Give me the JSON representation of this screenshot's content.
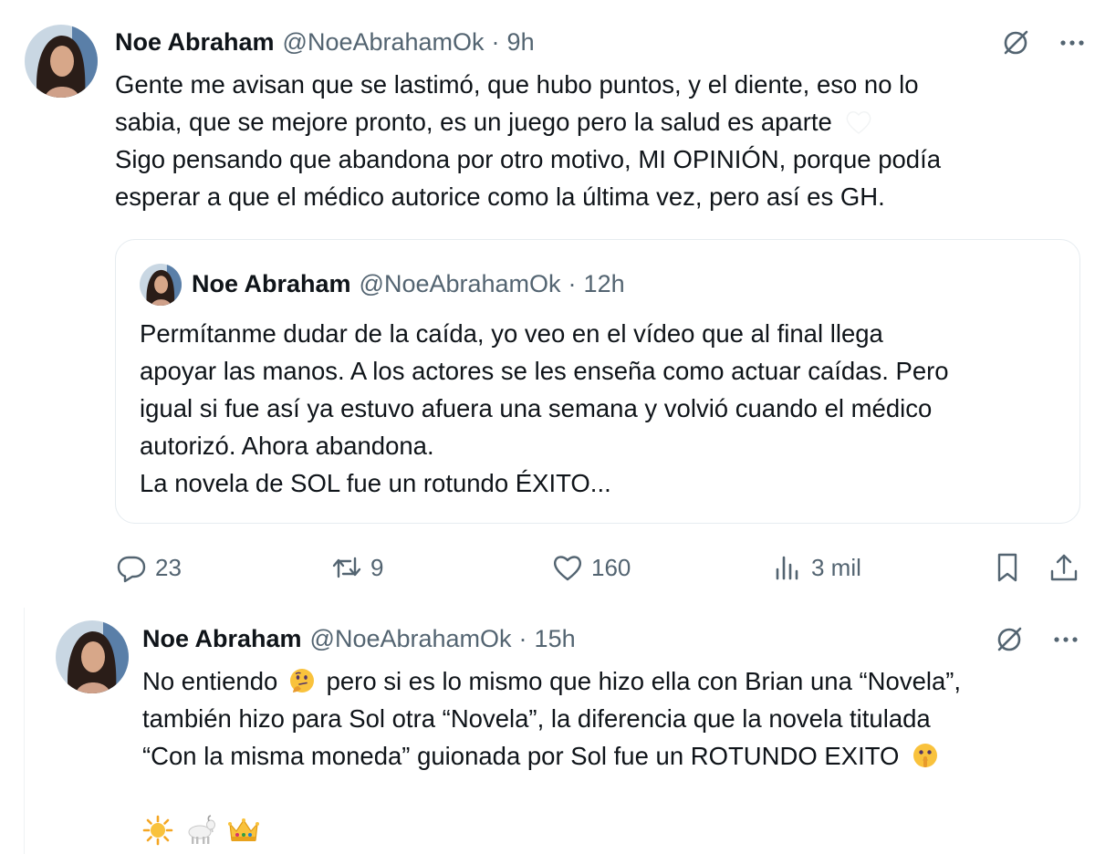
{
  "tweets": [
    {
      "author_name": "Noe Abraham",
      "author_handle": "@NoeAbrahamOk",
      "separator": "·",
      "time": "9h",
      "lines": [
        "Gente me avisan que se lastimó, que hubo puntos, y el diente, eso no lo",
        "sabia, que se mejore pronto, es un juego pero la salud es aparte",
        "Sigo pensando que abandona por otro motivo, MI OPINIÓN, porque podía",
        "esperar a que el médico autorice como la última vez, pero así es GH."
      ],
      "quoted": {
        "author_name": "Noe Abraham",
        "author_handle": "@NoeAbrahamOk",
        "separator": "·",
        "time": "12h",
        "lines": [
          "Permítanme dudar de la caída, yo veo en el vídeo que al final llega",
          "apoyar las manos. A los actores se les enseña como actuar caídas. Pero",
          "igual si fue así ya estuvo afuera una semana y volvió cuando el médico",
          "autorizó. Ahora abandona.",
          "La novela de SOL fue un rotundo ÉXITO..."
        ]
      },
      "actions": {
        "reply_count": "23",
        "retweet_count": "9",
        "like_count": "160",
        "views_count": "3 mil"
      }
    },
    {
      "author_name": "Noe Abraham",
      "author_handle": "@NoeAbrahamOk",
      "separator": "·",
      "time": "15h",
      "line1_before_emoji": "No entiendo",
      "line1_after_emoji": "pero si es lo mismo que hizo ella con Brian una “Novela”,",
      "line2": "también hizo para Sol otra “Novela”, la diferencia que la novela titulada",
      "line3": "“Con la misma moneda” guionada por Sol fue un ROTUNDO EXITO",
      "emojis_line1": "thinking-face",
      "emojis_line3": "shushing-face",
      "emoji_row": [
        "sun-emoji",
        "goat-emoji",
        "crown-emoji"
      ]
    }
  ],
  "colors": {
    "text": "#0f1419",
    "secondary": "#536471",
    "border": "#e6ecf0"
  }
}
